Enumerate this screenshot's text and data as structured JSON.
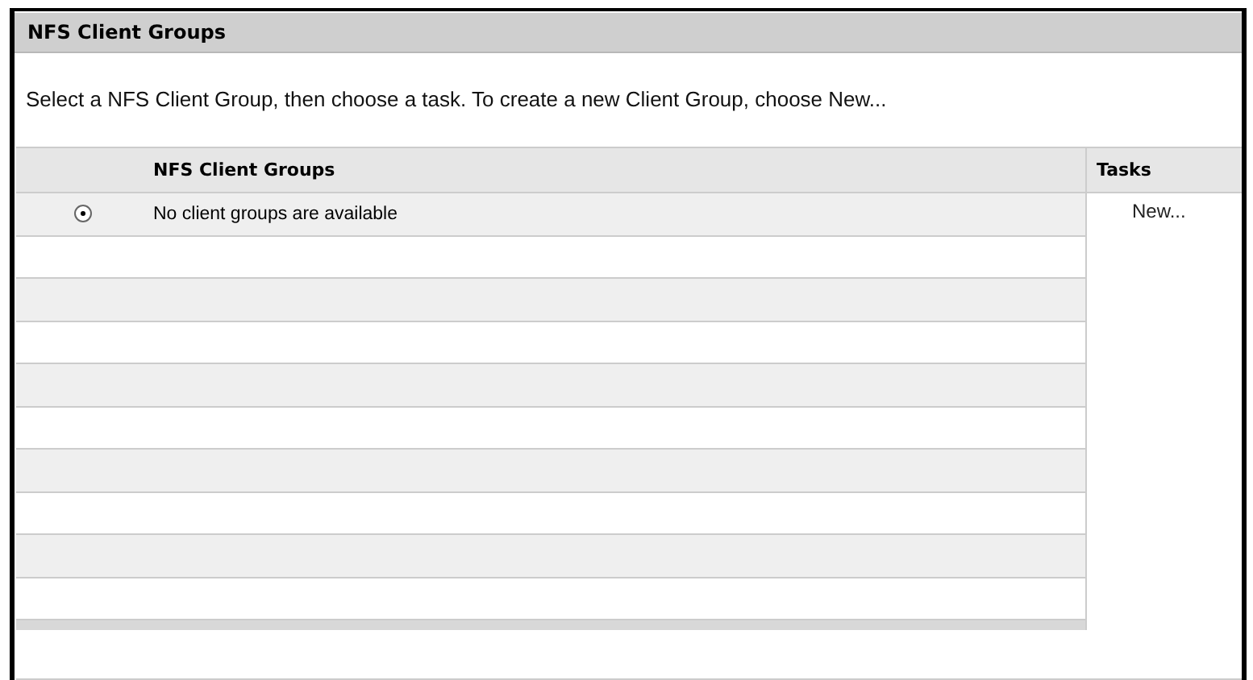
{
  "panel": {
    "title": "NFS Client Groups"
  },
  "instruction": "Select a NFS Client Group, then choose a task. To create a new Client Group, choose New...",
  "table": {
    "columns": [
      "NFS Client Groups",
      "Tasks"
    ],
    "rows": [
      {
        "name": "No client groups are available",
        "selected": true
      }
    ]
  },
  "tasks": [
    {
      "label": "New..."
    }
  ]
}
